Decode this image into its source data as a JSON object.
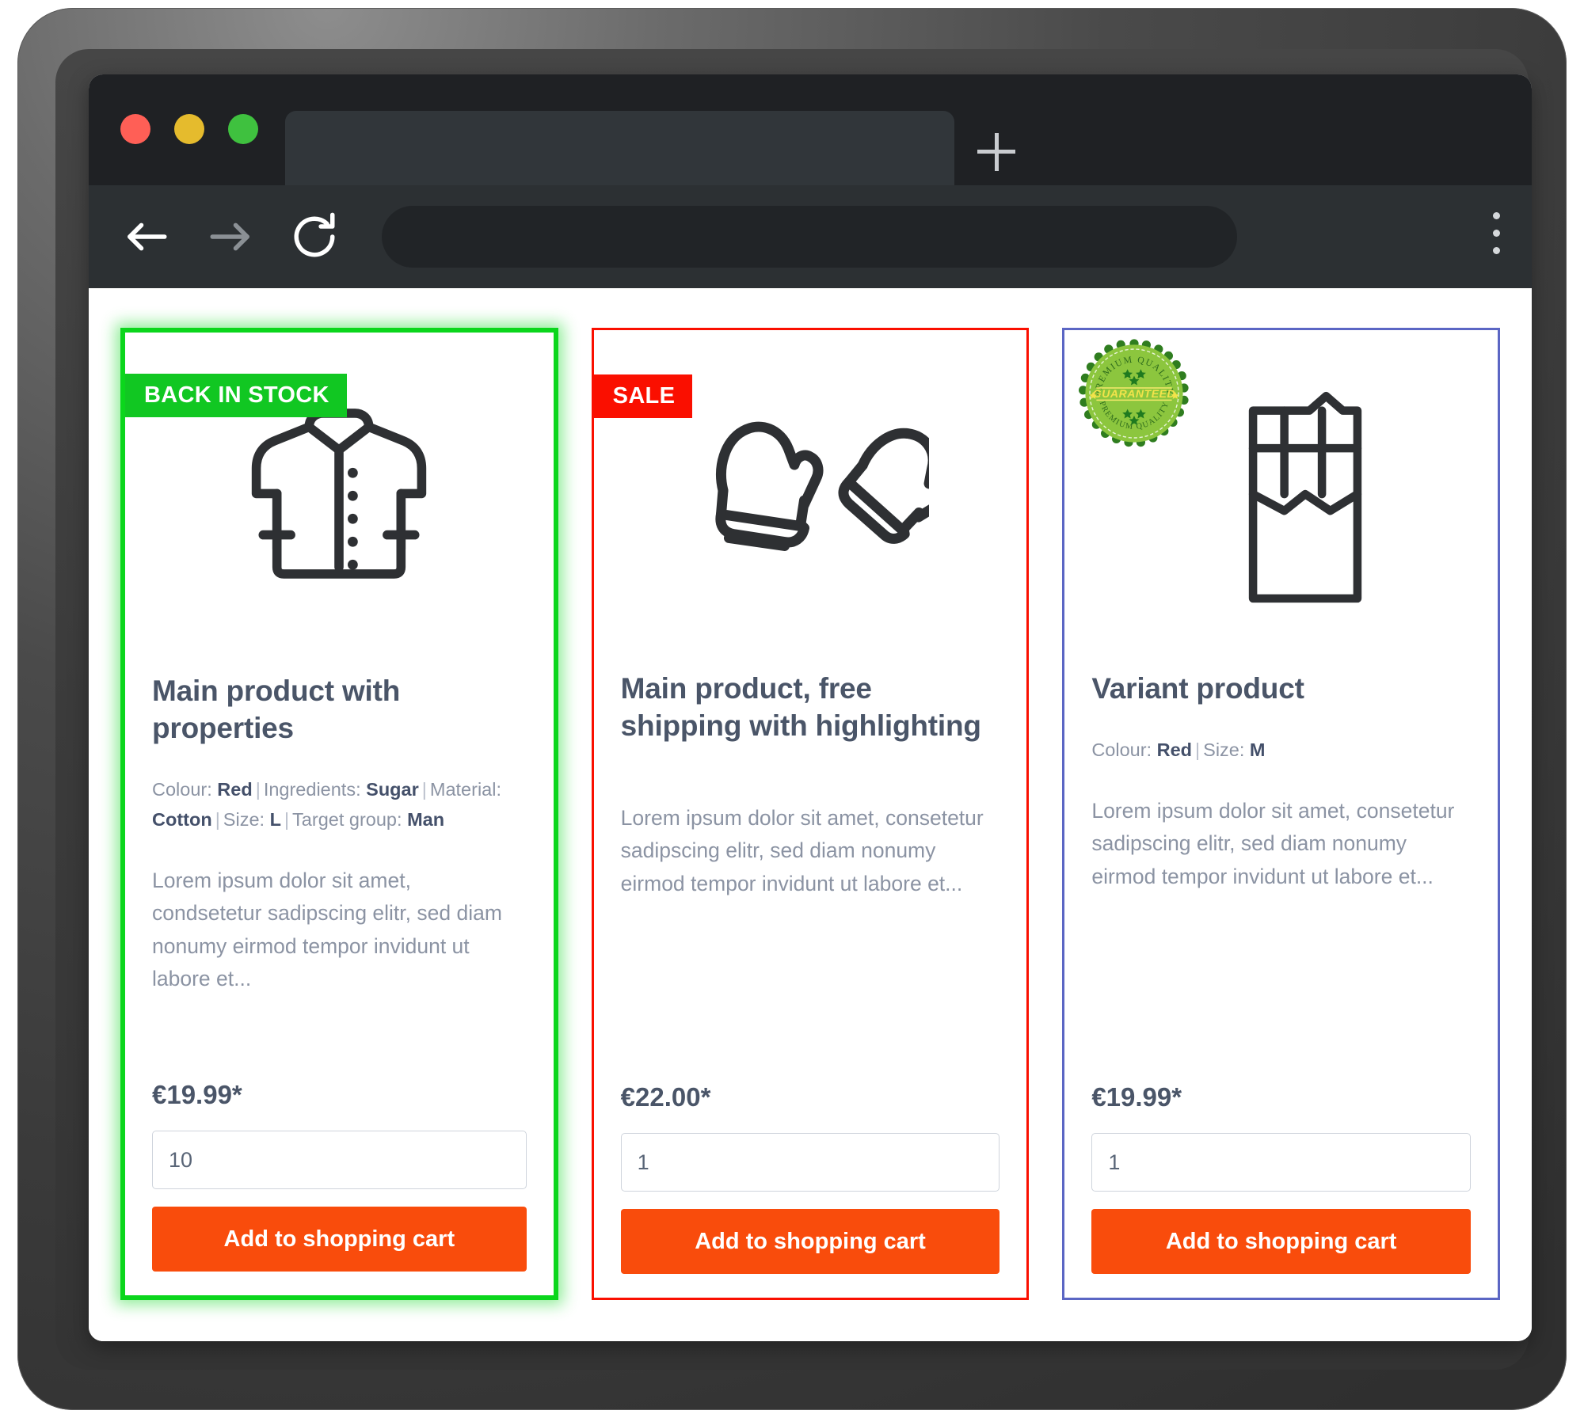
{
  "browser": {
    "traffic_lights": [
      "close-red",
      "minimize-yellow",
      "maximize-green"
    ],
    "tab_title": "",
    "new_tab_label": "+",
    "address_bar_value": "",
    "address_bar_placeholder": "",
    "back_label": "Back",
    "forward_label": "Forward",
    "reload_label": "Reload",
    "menu_label": "More"
  },
  "colors": {
    "badge_stock": "#11c722",
    "badge_sale": "#fa0f00",
    "card_border_green": "#0bd61c",
    "card_border_red": "#fa0f00",
    "card_border_blue": "#5b66c4",
    "cart_button": "#f94c0c",
    "title_text": "#4a5568",
    "muted_text": "#8b93a3"
  },
  "products": [
    {
      "badge": "BACK IN STOCK",
      "icon": "shirt-icon",
      "title": "Main product with properties",
      "properties": [
        {
          "label": "Colour:",
          "value": "Red"
        },
        {
          "label": "Ingredients:",
          "value": "Sugar"
        },
        {
          "label": "Material:",
          "value": "Cotton"
        },
        {
          "label": "Size:",
          "value": "L"
        },
        {
          "label": "Target group:",
          "value": "Man"
        }
      ],
      "description": "Lorem ipsum dolor sit amet, condsetetur sadipscing elitr, sed diam nonumy eirmod tempor invidunt ut labore et...",
      "price": "€19.99*",
      "quantity": "10",
      "cart_label": "Add to shopping cart"
    },
    {
      "badge": "SALE",
      "icon": "mittens-icon",
      "title": "Main product, free shipping with highlighting",
      "properties": [],
      "description": "Lorem ipsum dolor sit amet, consetetur sadipscing elitr, sed diam nonumy eirmod tempor invidunt ut labore et...",
      "price": "€22.00*",
      "quantity": "1",
      "cart_label": "Add to shopping cart"
    },
    {
      "badge": "",
      "icon": "chocolate-bar-icon",
      "seal": {
        "top_text": "PREMIUM QUALITY",
        "center_text": "GUARANTEED",
        "bottom_text": "PREMIUM QUALITY"
      },
      "title": "Variant product",
      "properties": [
        {
          "label": "Colour:",
          "value": "Red"
        },
        {
          "label": "Size:",
          "value": "M"
        }
      ],
      "description": "Lorem ipsum dolor sit amet, consetetur sadipscing elitr, sed diam nonumy eirmod tempor invidunt ut labore et...",
      "price": "€19.99*",
      "quantity": "1",
      "cart_label": "Add to shopping cart"
    }
  ]
}
